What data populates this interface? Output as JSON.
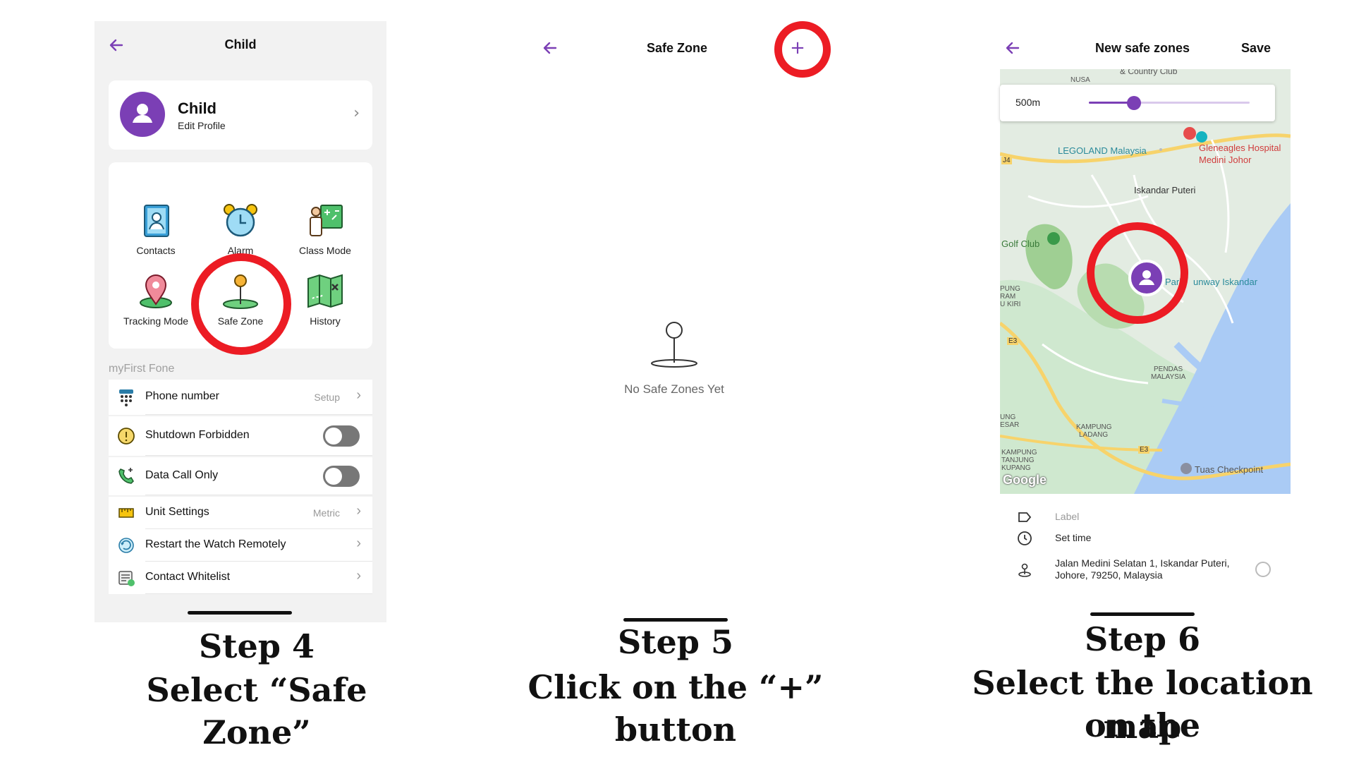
{
  "colors": {
    "accent": "#7b3fb5",
    "highlight_ring": "#ec1c24"
  },
  "step4": {
    "screen": {
      "title": "Child",
      "profile": {
        "name": "Child",
        "subtitle": "Edit Profile"
      },
      "features": [
        {
          "label": "Contacts",
          "icon": "contacts-book-icon"
        },
        {
          "label": "Alarm",
          "icon": "alarm-clock-icon"
        },
        {
          "label": "Class Mode",
          "icon": "class-mode-teacher-icon"
        },
        {
          "label": "Tracking Mode",
          "icon": "location-pin-icon"
        },
        {
          "label": "Safe Zone",
          "icon": "safe-zone-pin-icon"
        },
        {
          "label": "History",
          "icon": "history-map-icon"
        }
      ],
      "section_header": "myFirst Fone",
      "settings": [
        {
          "label": "Phone number",
          "value": "Setup",
          "icon": "dialpad-icon"
        },
        {
          "label": "Shutdown Forbidden",
          "icon": "warning-circle-icon",
          "toggle": "off"
        },
        {
          "label": "Data Call Only",
          "icon": "phone-call-icon",
          "toggle": "off"
        },
        {
          "label": "Unit Settings",
          "value": "Metric",
          "icon": "ruler-icon"
        },
        {
          "label": "Restart the Watch Remotely",
          "icon": "restart-icon"
        },
        {
          "label": "Contact Whitelist",
          "icon": "whitelist-icon"
        }
      ]
    },
    "caption_step": "Step 4",
    "caption_action": "Select “Safe Zone”"
  },
  "step5": {
    "screen": {
      "title": "Safe Zone",
      "add_button": "+",
      "empty_text": "No Safe Zones Yet"
    },
    "caption_step": "Step 5",
    "caption_action": "Click on the “+” button"
  },
  "step6": {
    "screen": {
      "title": "New safe zones",
      "save": "Save",
      "radius_label": "500m",
      "radius_fraction": 0.28,
      "map_labels": [
        "& Country Club",
        "NUSA",
        "LEGOLAND Malaysia",
        "Gleneagles Hospital",
        "Medini Johor",
        "Iskandar Puteri",
        "Golf Club",
        "Park",
        "unway Iskandar",
        "PUNG",
        "RAM",
        "U KIRI",
        "PENDAS",
        "MALAYSIA",
        "UNG",
        "ESAR",
        "KAMPUNG",
        "LADANG",
        "KAMPUNG",
        "TANJUNG",
        "KUPANG",
        "Tuas Checkpoint",
        "J4",
        "E3",
        "E3",
        "Google"
      ],
      "label_placeholder": "Label",
      "set_time": "Set time",
      "address_line1": "Jalan Medini Selatan 1, Iskandar Puteri,",
      "address_line2": "Johore, 79250, Malaysia"
    },
    "caption_step": "Step 6",
    "caption_action_line1": "Select the location on the",
    "caption_action_line2": "map"
  }
}
